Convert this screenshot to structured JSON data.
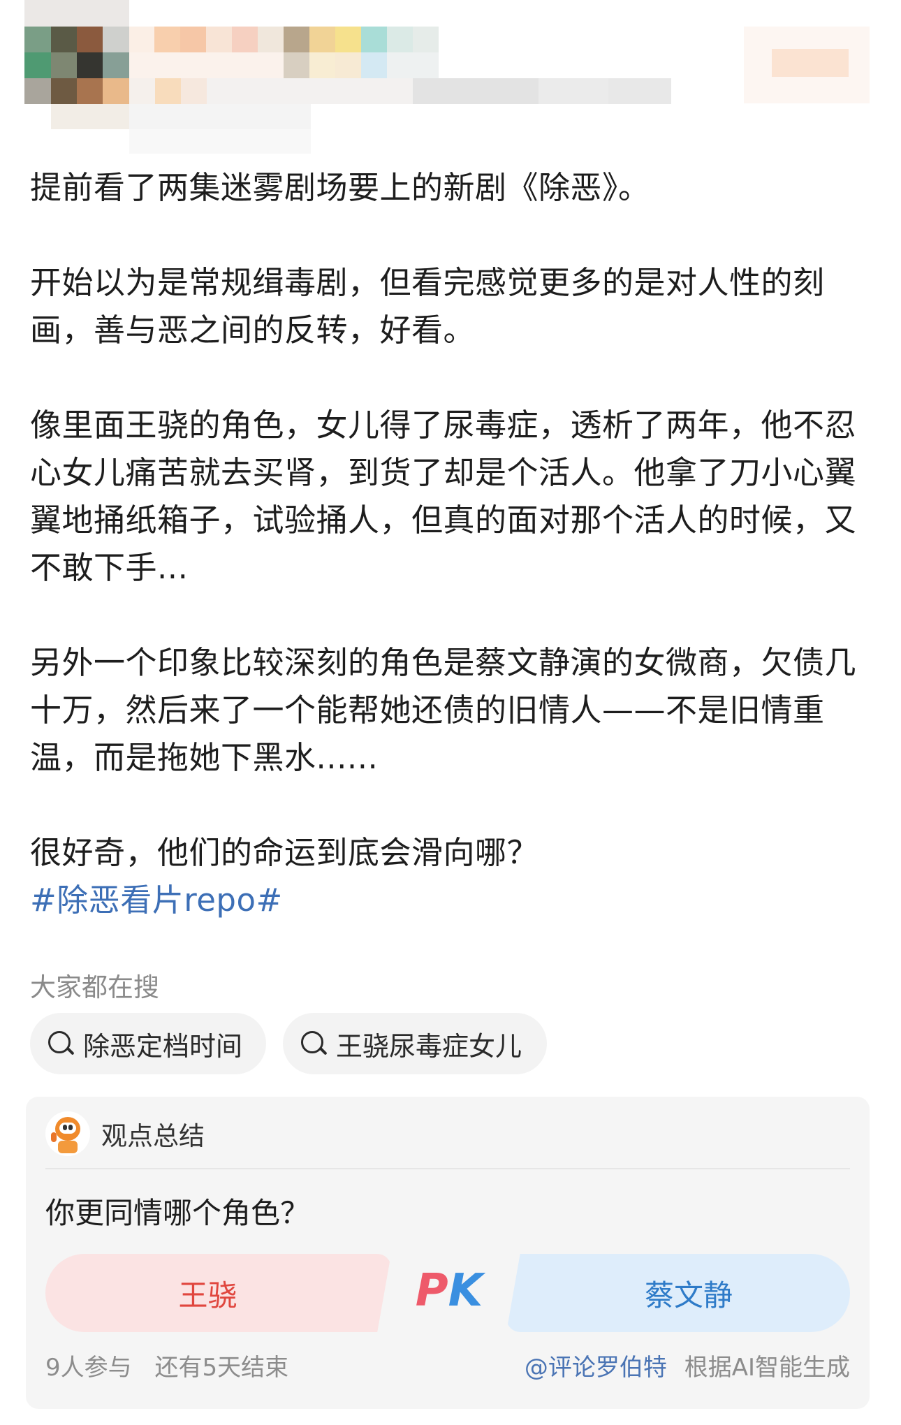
{
  "post": {
    "paragraphs": [
      "提前看了两集迷雾剧场要上的新剧《除恶》。",
      "开始以为是常规缉毒剧，但看完感觉更多的是对人性的刻画，善与恶之间的反转，好看。",
      "像里面王骁的角色，女儿得了尿毒症，透析了两年，他不忍心女儿痛苦就去买肾，到货了却是个活人。他拿了刀小心翼翼地捅纸箱子，试验捅人，但真的面对那个活人的时候，又不敢下手...",
      "另外一个印象比较深刻的角色是蔡文静演的女微商，欠债几十万，然后来了一个能帮她还债的旧情人——不是旧情重温，而是拖她下黑水......",
      "很好奇，他们的命运到底会滑向哪？"
    ],
    "hashtag": "#除恶看片repo#"
  },
  "search": {
    "label": "大家都在搜",
    "chips": [
      "除恶定档时间",
      "王骁尿毒症女儿"
    ]
  },
  "summary_card": {
    "title": "观点总结",
    "question": "你更同情哪个角色？",
    "option_left": "王骁",
    "option_right": "蔡文静",
    "pk_p": "P",
    "pk_k": "K",
    "participants": "9人参与",
    "remaining": "还有5天结束",
    "author": "@评论罗伯特",
    "source_note": "根据AI智能生成"
  },
  "colors": {
    "hashtag": "#3d6fb6",
    "left_option_text": "#e0463e",
    "right_option_text": "#2e7bc8"
  }
}
